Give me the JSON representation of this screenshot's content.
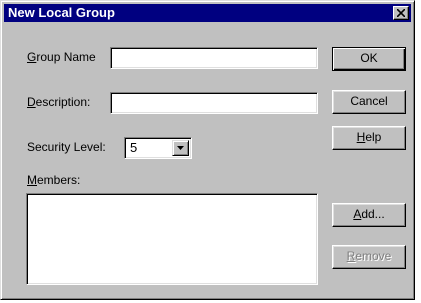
{
  "window": {
    "title": "New Local Group"
  },
  "form": {
    "group_name": {
      "label_accel": "G",
      "label_rest": "roup Name",
      "value": ""
    },
    "description": {
      "label_accel": "D",
      "label_rest": "escription:",
      "value": ""
    },
    "security_level": {
      "label": "Security Level:",
      "value": "5"
    },
    "members": {
      "label_accel": "M",
      "label_rest": "embers:",
      "items": []
    }
  },
  "buttons": {
    "ok": "OK",
    "cancel": "Cancel",
    "help_accel": "H",
    "help_rest": "elp",
    "add_accel": "A",
    "add_rest": "dd...",
    "remove_accel": "R",
    "remove_rest": "emove"
  },
  "colors": {
    "titlebar": "#000080",
    "face": "#c0c0c0",
    "disabled_text": "#808080"
  },
  "icons": {
    "close": "close-icon",
    "dropdown": "chevron-down-icon"
  }
}
